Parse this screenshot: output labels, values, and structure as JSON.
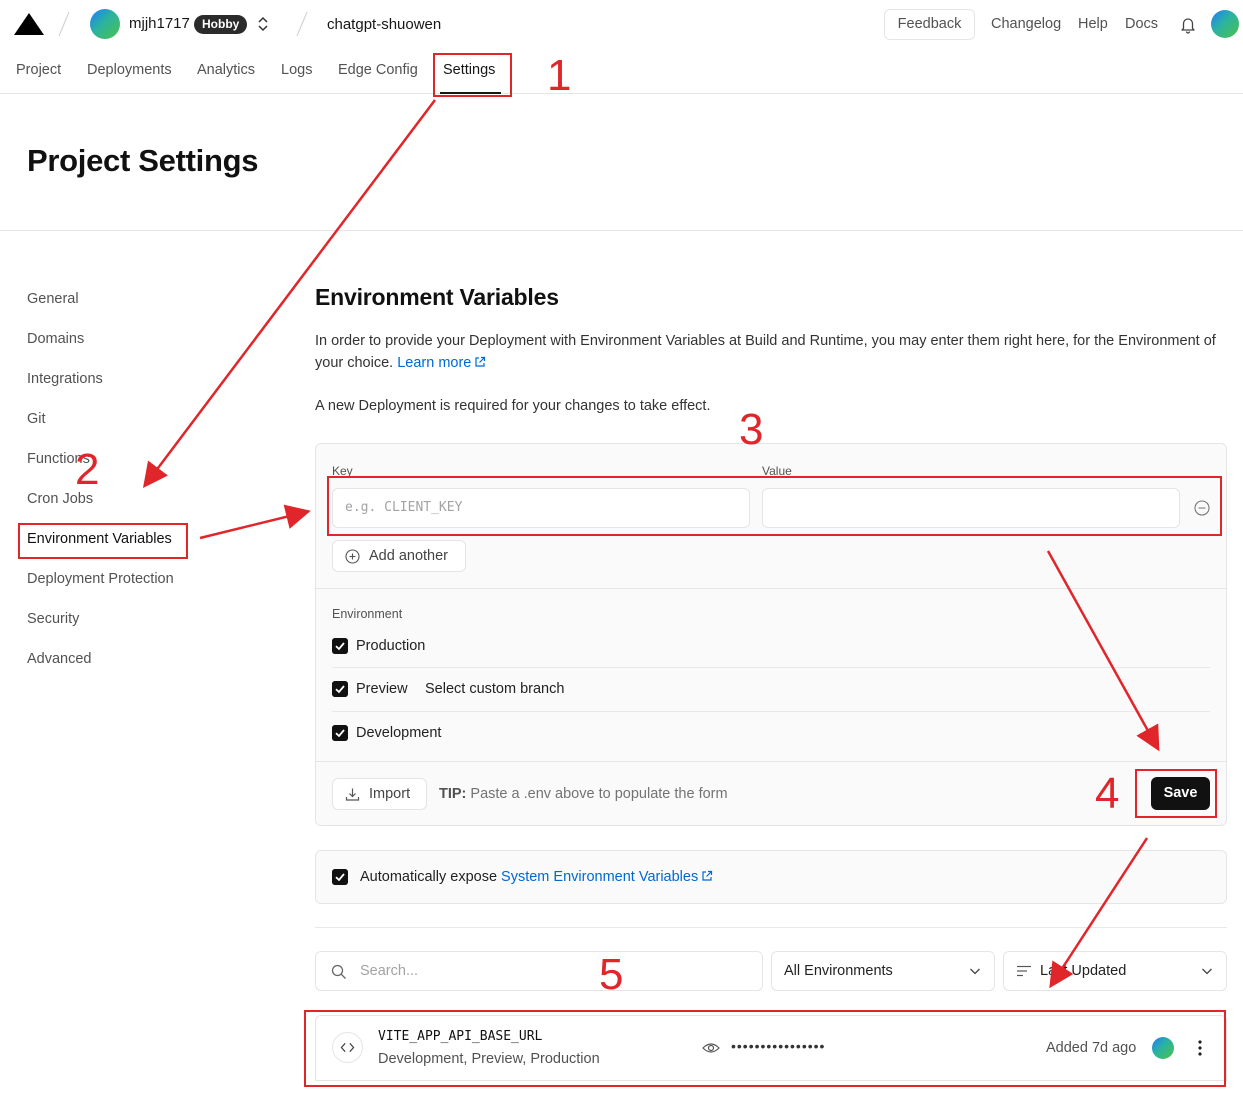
{
  "header": {
    "team_name": "mjjh1717",
    "plan_badge": "Hobby",
    "project_name": "chatgpt-shuowen",
    "feedback_label": "Feedback",
    "links": [
      "Changelog",
      "Help",
      "Docs"
    ]
  },
  "tabs": [
    "Project",
    "Deployments",
    "Analytics",
    "Logs",
    "Edge Config",
    "Settings"
  ],
  "active_tab": "Settings",
  "page_title": "Project Settings",
  "sidebar": {
    "items": [
      "General",
      "Domains",
      "Integrations",
      "Git",
      "Functions",
      "Cron Jobs",
      "Environment Variables",
      "Deployment Protection",
      "Security",
      "Advanced"
    ],
    "active": "Environment Variables"
  },
  "env_vars": {
    "title": "Environment Variables",
    "description": "In order to provide your Deployment with Environment Variables at Build and Runtime, you may enter them right here, for the Environment of your choice.",
    "learn_more": "Learn more",
    "redeploy_note": "A new Deployment is required for your changes to take effect.",
    "key_label": "Key",
    "key_placeholder": "e.g. CLIENT_KEY",
    "value_label": "Value",
    "value_value": "",
    "add_another": "Add another",
    "environment_label": "Environment",
    "environments": [
      {
        "label": "Production",
        "checked": true
      },
      {
        "label": "Preview",
        "checked": true,
        "link": "Select custom branch"
      },
      {
        "label": "Development",
        "checked": true
      }
    ],
    "import_label": "Import",
    "tip_prefix": "TIP:",
    "tip_text": "Paste a .env above to populate the form",
    "save_label": "Save",
    "auto_expose_prefix": "Automatically expose",
    "auto_expose_link": "System Environment Variables",
    "auto_expose_checked": true
  },
  "list": {
    "search_placeholder": "Search...",
    "env_filter": "All Environments",
    "sort": "Last Updated",
    "rows": [
      {
        "name": "VITE_APP_API_BASE_URL",
        "environments": "Development, Preview, Production",
        "masked_value": "••••••••••••••••",
        "added": "Added 7d ago"
      }
    ]
  },
  "annotations": {
    "numbers": [
      "1",
      "2",
      "3",
      "4",
      "5"
    ],
    "color": "#e0262a"
  },
  "colors": {
    "link": "#0068d6",
    "primary_button": "#111111"
  }
}
